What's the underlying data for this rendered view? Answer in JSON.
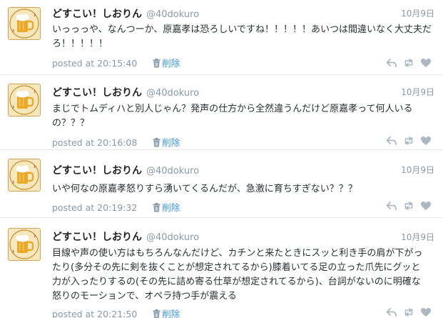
{
  "user": {
    "display_name": "どすこい！しおりん",
    "screen_name": "@40dokuro"
  },
  "delete_label": "削除",
  "posted_prefix": "posted at",
  "icons": {
    "reply": "reply-icon",
    "retweet": "retweet-icon",
    "like": "heart-icon",
    "delete": "trash-icon"
  },
  "colors": {
    "link": "#3b94d9",
    "muted": "#8899a6"
  },
  "tweets": [
    {
      "date": "10月9日",
      "text": "いっっっや、なんつーか、原嘉孝は恐ろしいですね！！！！！あいつは間違いなく大丈夫だろ！！！！！",
      "time": "20:15:40"
    },
    {
      "date": "10月9日",
      "text": "まじでトムディハと別人じゃん？発声の仕方から全然違うんだけど原嘉孝って何人いるの？？？",
      "time": "20:16:08"
    },
    {
      "date": "10月9日",
      "text": "いや何なの原嘉孝怒りすら湧いてくるんだが、急激に育ちすぎない？？？",
      "time": "20:19:32"
    },
    {
      "date": "10月9日",
      "text": "目線や声の使い方はもちろんなんだけど、カチンと来たときにスッと利き手の肩が下がったり(多分その先に剣を抜くことが想定されてるから)膝着いてる足の立った爪先にグッと力が入ったりするの(その先に詰め寄る仕草が想定されてるから)、台詞がないのに明確な怒りのモーションで、オペラ持つ手が震える",
      "time": "20:21:50"
    }
  ]
}
